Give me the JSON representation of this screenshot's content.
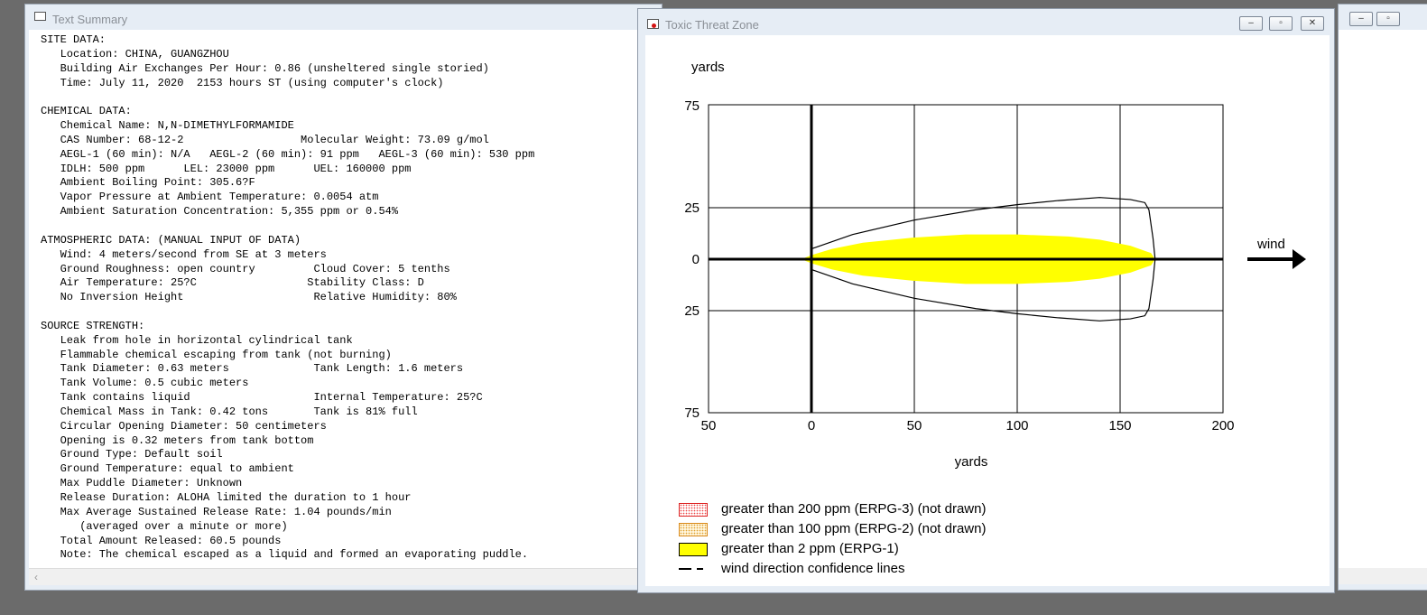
{
  "text_window": {
    "title": "Text Summary",
    "summary_lines": [
      "SITE DATA:",
      "   Location: CHINA, GUANGZHOU",
      "   Building Air Exchanges Per Hour: 0.86 (unsheltered single storied)",
      "   Time: July 11, 2020  2153 hours ST (using computer's clock)",
      "",
      "CHEMICAL DATA:",
      "   Chemical Name: N,N-DIMETHYLFORMAMIDE",
      "   CAS Number: 68-12-2                  Molecular Weight: 73.09 g/mol",
      "   AEGL-1 (60 min): N/A   AEGL-2 (60 min): 91 ppm   AEGL-3 (60 min): 530 ppm",
      "   IDLH: 500 ppm      LEL: 23000 ppm      UEL: 160000 ppm",
      "   Ambient Boiling Point: 305.6?F",
      "   Vapor Pressure at Ambient Temperature: 0.0054 atm",
      "   Ambient Saturation Concentration: 5,355 ppm or 0.54%",
      "",
      "ATMOSPHERIC DATA: (MANUAL INPUT OF DATA)",
      "   Wind: 4 meters/second from SE at 3 meters",
      "   Ground Roughness: open country         Cloud Cover: 5 tenths",
      "   Air Temperature: 25?C                 Stability Class: D",
      "   No Inversion Height                    Relative Humidity: 80%",
      "",
      "SOURCE STRENGTH:",
      "   Leak from hole in horizontal cylindrical tank",
      "   Flammable chemical escaping from tank (not burning)",
      "   Tank Diameter: 0.63 meters             Tank Length: 1.6 meters",
      "   Tank Volume: 0.5 cubic meters",
      "   Tank contains liquid                   Internal Temperature: 25?C",
      "   Chemical Mass in Tank: 0.42 tons       Tank is 81% full",
      "   Circular Opening Diameter: 50 centimeters",
      "   Opening is 0.32 meters from tank bottom",
      "   Ground Type: Default soil",
      "   Ground Temperature: equal to ambient",
      "   Max Puddle Diameter: Unknown",
      "   Release Duration: ALOHA limited the duration to 1 hour",
      "   Max Average Sustained Release Rate: 1.04 pounds/min",
      "      (averaged over a minute or more)",
      "   Total Amount Released: 60.5 pounds",
      "   Note: The chemical escaped as a liquid and formed an evaporating puddle."
    ],
    "scroll_left_glyph": "‹"
  },
  "threat_window": {
    "title": "Toxic Threat Zone",
    "buttons": {
      "minimize": "–",
      "maximize": "▫",
      "close": "✕"
    }
  },
  "background_window": {
    "buttons": {
      "minimize": "–",
      "maximize": "▫"
    }
  },
  "chart_data": {
    "type": "area",
    "ylabel": "yards",
    "xlabel": "yards",
    "wind_label": "wind",
    "xlim": [
      -50,
      200
    ],
    "ylim": [
      -75,
      75
    ],
    "x_ticks": [
      -50,
      0,
      50,
      100,
      150,
      200
    ],
    "x_tick_labels": [
      "50",
      "0",
      "50",
      "100",
      "150",
      "200"
    ],
    "y_ticks": [
      75,
      25,
      0,
      -25,
      -75
    ],
    "y_tick_labels": [
      "75",
      "25",
      "0",
      "25",
      "75"
    ],
    "grid": true,
    "zone_erpg1": {
      "fill": "#ffff00",
      "upper": [
        [
          -5,
          0
        ],
        [
          0,
          2
        ],
        [
          10,
          5
        ],
        [
          25,
          8
        ],
        [
          50,
          10.5
        ],
        [
          75,
          12
        ],
        [
          100,
          12
        ],
        [
          125,
          11
        ],
        [
          140,
          9.5
        ],
        [
          155,
          6.5
        ],
        [
          165,
          3
        ],
        [
          167,
          0
        ]
      ],
      "lower": [
        [
          -5,
          0
        ],
        [
          0,
          -2
        ],
        [
          10,
          -5
        ],
        [
          25,
          -8
        ],
        [
          50,
          -10.5
        ],
        [
          75,
          -12
        ],
        [
          100,
          -12
        ],
        [
          125,
          -11
        ],
        [
          140,
          -9.5
        ],
        [
          155,
          -6.5
        ],
        [
          165,
          -3
        ],
        [
          167,
          0
        ]
      ]
    },
    "confidence_lines": {
      "upper": [
        [
          0,
          5
        ],
        [
          20,
          12
        ],
        [
          50,
          19
        ],
        [
          80,
          24
        ],
        [
          100,
          26.5
        ],
        [
          120,
          28.5
        ],
        [
          140,
          30
        ],
        [
          155,
          29
        ],
        [
          162,
          27.5
        ],
        [
          164,
          24
        ],
        [
          166,
          10
        ],
        [
          167,
          0
        ]
      ],
      "lower": [
        [
          0,
          -5
        ],
        [
          20,
          -12
        ],
        [
          50,
          -19
        ],
        [
          80,
          -24
        ],
        [
          100,
          -26.5
        ],
        [
          120,
          -28.5
        ],
        [
          140,
          -30
        ],
        [
          155,
          -29
        ],
        [
          162,
          -27.5
        ],
        [
          164,
          -24
        ],
        [
          166,
          -10
        ],
        [
          167,
          0
        ]
      ]
    },
    "legend": [
      {
        "swatch": "erpg3",
        "label": "greater than 200 ppm (ERPG-3) (not drawn)"
      },
      {
        "swatch": "erpg2",
        "label": "greater than 100 ppm (ERPG-2) (not drawn)"
      },
      {
        "swatch": "erpg1",
        "label": "greater than 2 ppm (ERPG-1)"
      },
      {
        "swatch": "wind",
        "label": "wind direction confidence lines"
      }
    ]
  }
}
